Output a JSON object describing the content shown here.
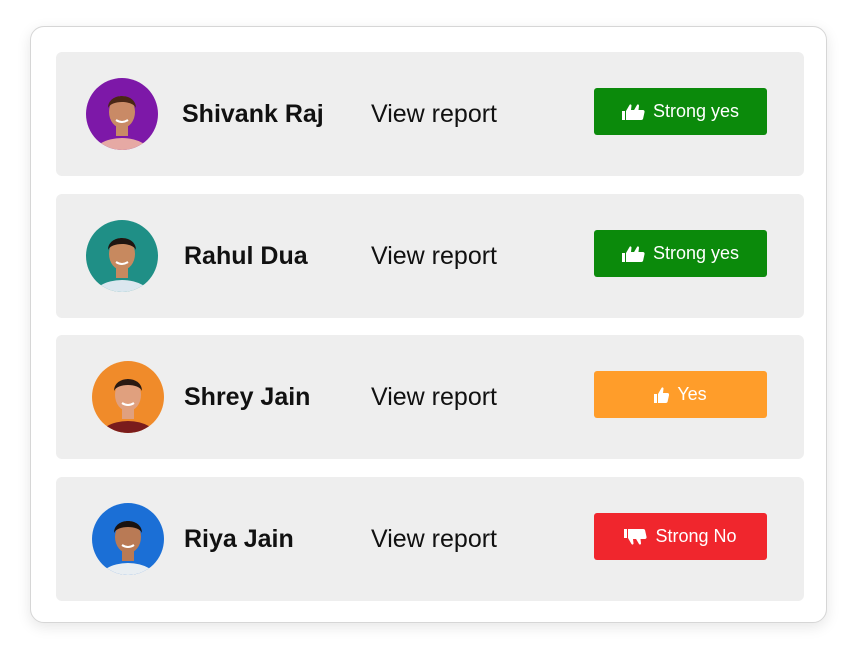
{
  "rows": [
    {
      "name": "Shivank Raj",
      "link_label": "View report",
      "verdict": {
        "label": "Strong yes",
        "icon": "double-thumbs-up-icon",
        "color": "#0b8a0b"
      },
      "avatar_colors": {
        "background": "#7d18a8",
        "skin": "#c98a66",
        "hair": "#4a2716",
        "shirt": "#e6a9a4"
      }
    },
    {
      "name": "Rahul Dua",
      "link_label": "View report",
      "verdict": {
        "label": "Strong yes",
        "icon": "double-thumbs-up-icon",
        "color": "#0b8a0b"
      },
      "avatar_colors": {
        "background": "#1f8f86",
        "skin": "#c7895f",
        "hair": "#1f1510",
        "shirt": "#dbe7ef"
      }
    },
    {
      "name": "Shrey Jain",
      "link_label": "View report",
      "verdict": {
        "label": "Yes",
        "icon": "thumbs-up-icon",
        "color": "#ff9d2a"
      },
      "avatar_colors": {
        "background": "#f08b2a",
        "skin": "#e0a07e",
        "hair": "#2a1a12",
        "shirt": "#7a1c1c"
      }
    },
    {
      "name": "Riya Jain",
      "link_label": "View report",
      "verdict": {
        "label": "Strong No",
        "icon": "double-thumbs-down-icon",
        "color": "#f0262d"
      },
      "avatar_colors": {
        "background": "#1b6fd6",
        "skin": "#b97a55",
        "hair": "#1a1210",
        "shirt": "#e9eef2"
      }
    }
  ]
}
